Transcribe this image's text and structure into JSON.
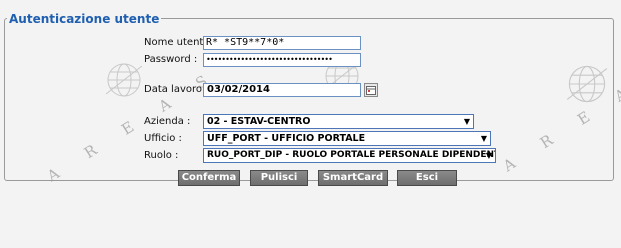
{
  "legend": "Autenticazione utente",
  "form": {
    "username_label": "Nome utente :",
    "username_value": "R*  *ST9**7*0*",
    "password_label": "Password :",
    "password_value": "•••••••••••••••••••••••••••••••••",
    "date_label": "Data lavoro :",
    "date_value": "03/02/2014",
    "azienda_label": "Azienda :",
    "azienda_value": "02 - ESTAV-CENTRO",
    "ufficio_label": "Ufficio :",
    "ufficio_value": "UFF_PORT - UFFICIO PORTALE",
    "ruolo_label": "Ruolo :",
    "ruolo_value": "RUO_PORT_DIP - RUOLO PORTALE PERSONALE DIPENDENTE"
  },
  "buttons": {
    "confirm": "Conferma",
    "clear": "Pulisci",
    "smartcard": "SmartCard",
    "exit": "Esci"
  },
  "watermark": {
    "left": "A R E A S",
    "right": "A R E A S"
  },
  "icons": {
    "dropdown": "▼",
    "calendar": "calendar-icon"
  }
}
